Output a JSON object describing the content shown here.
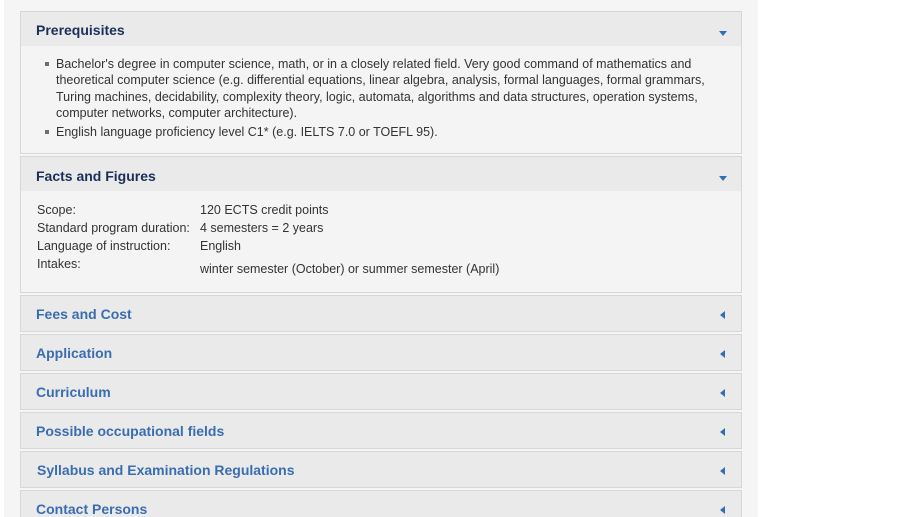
{
  "prerequisites": {
    "title": "Prerequisites",
    "items": [
      "Bachelor's degree in computer science, math, or in a closely related field. Very good command of mathematics and theoretical computer science (e.g. differential equations, linear algebra, analysis, formal languages, formal grammars, Turing machines, decidability, complexity theory, logic, automata, algorithms and data structures, operation systems, computer networks, computer architecture).",
      "English language proficiency level C1* (e.g. IELTS 7.0 or TOEFL 95)."
    ]
  },
  "facts": {
    "title": "Facts and Figures",
    "rows": [
      {
        "label": "Scope:",
        "value": "120 ECTS credit points"
      },
      {
        "label": "Standard program duration:",
        "value": "4 semesters = 2 years"
      },
      {
        "label": "Language of instruction:",
        "value": "English"
      },
      {
        "label": "Intakes:",
        "value": "winter semester (October) or summer semester (April)"
      }
    ]
  },
  "collapsed_sections": [
    {
      "title": "Fees and Cost"
    },
    {
      "title": "Application"
    },
    {
      "title": "Curriculum"
    },
    {
      "title": "Possible occupational fields"
    },
    {
      "title": "Syllabus and Examination Regulations"
    },
    {
      "title": "Contact Persons"
    }
  ],
  "icons": {
    "expanded": "chevron-down-icon",
    "collapsed": "chevron-left-icon"
  },
  "colors": {
    "open_title": "#1b2f59",
    "closed_title": "#3a6db0",
    "arrow": "#2f6fb5"
  }
}
